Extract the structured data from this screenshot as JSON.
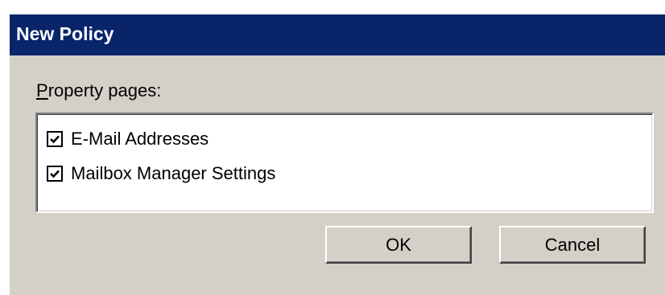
{
  "dialog": {
    "title": "New Policy",
    "property_pages_label_first": "P",
    "property_pages_label_rest": "roperty pages:",
    "items": [
      {
        "label": "E-Mail Addresses",
        "checked": true
      },
      {
        "label": "Mailbox Manager Settings",
        "checked": true
      }
    ],
    "ok_label": "OK",
    "cancel_label": "Cancel"
  },
  "colors": {
    "title_bar": "#0a246a",
    "dialog_bg": "#d4d0c8",
    "list_bg": "#ffffff"
  },
  "icons": {
    "checkbox_checked": "checkbox-checked-icon"
  }
}
